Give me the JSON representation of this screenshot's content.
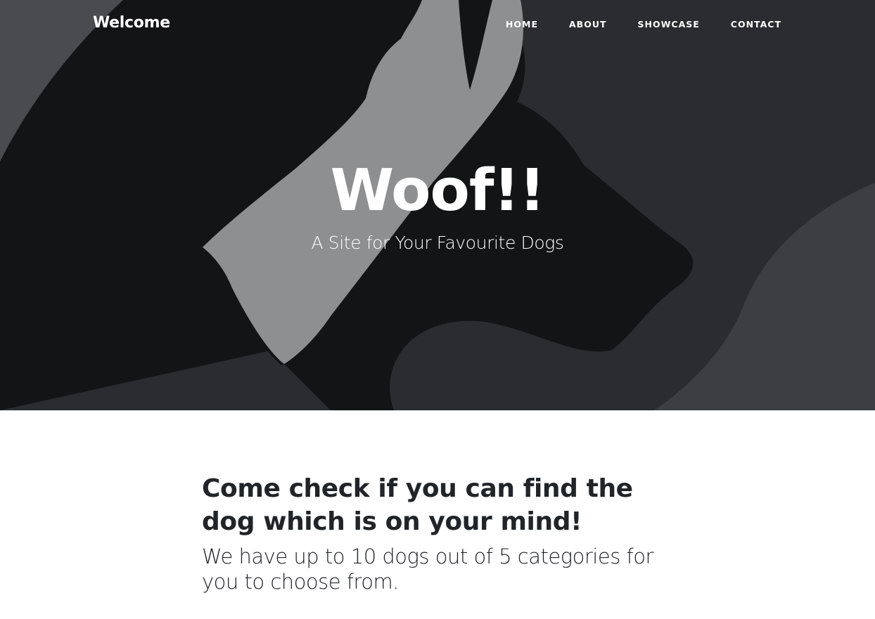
{
  "navbar": {
    "brand": "Welcome",
    "links": [
      "HOME",
      "ABOUT",
      "SHOWCASE",
      "CONTACT"
    ]
  },
  "hero": {
    "title": "Woof!!",
    "subtitle": "A Site for Your Favourite Dogs"
  },
  "intro": {
    "heading": "Come check if you can find the dog which is on your mind!",
    "text": "We have up to 10 dogs out of 5 categories for you to choose from."
  },
  "colors": {
    "hero_dark": "#131416",
    "hero_mid": "#2b2c2f",
    "hero_light": "#8e8f91",
    "hero_edge": "#3d3e41",
    "text_dark": "#212529"
  },
  "icons": [
    "dog-silhouette-graphic"
  ]
}
